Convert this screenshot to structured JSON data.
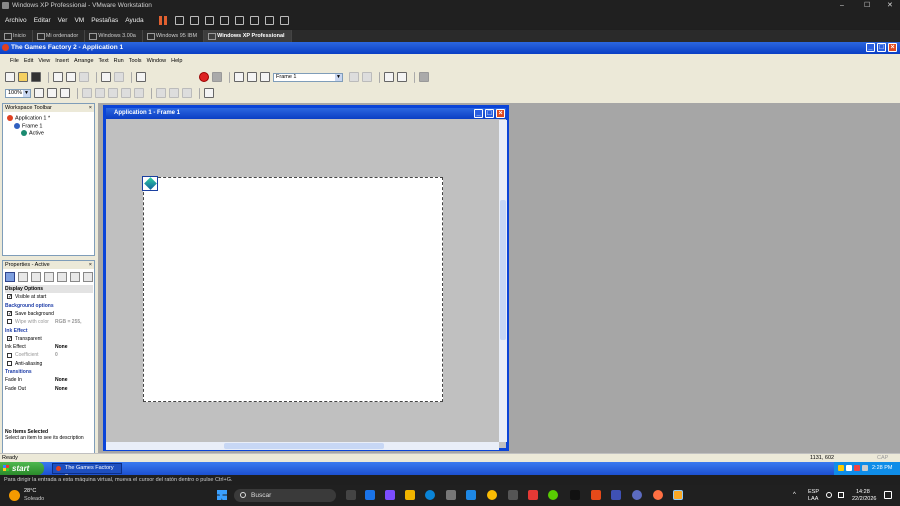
{
  "vm": {
    "window_title": "Windows XP Professional - VMware Workstation",
    "menu": [
      "Archivo",
      "Editar",
      "Ver",
      "VM",
      "Pestañas",
      "Ayuda"
    ],
    "tabs": [
      "Inicio",
      "Mi ordenador",
      "Windows 3.00a",
      "Windows 95 IBM",
      "Windows XP Professional"
    ],
    "active_tab": "Windows XP Professional",
    "window_controls": {
      "minimize": "–",
      "maximize": "☐",
      "close": "✕"
    }
  },
  "app": {
    "title": "The Games Factory 2 - Application 1",
    "menu": [
      "File",
      "Edit",
      "View",
      "Insert",
      "Arrange",
      "Text",
      "Run",
      "Tools",
      "Window",
      "Help"
    ],
    "frame_select": "Frame 1",
    "zoom": "100%"
  },
  "workspace": {
    "title": "Workspace Toolbar",
    "tree": [
      {
        "label": "Application 1 *",
        "icon": "application-icon",
        "level": 0
      },
      {
        "label": "Frame 1",
        "icon": "frame-icon",
        "level": 1
      },
      {
        "label": "Active",
        "icon": "active-object-icon",
        "level": 2
      }
    ]
  },
  "properties": {
    "title": "Properties - Active",
    "rows": [
      {
        "type": "hdr",
        "label": "Display Options"
      },
      {
        "type": "check",
        "label": "Visible at start",
        "checked": true
      },
      {
        "type": "sec",
        "label": "Background options"
      },
      {
        "type": "check",
        "label": "Save background",
        "checked": true
      },
      {
        "type": "disabled",
        "label": "Wipe with color",
        "value": "RGB = 255,"
      },
      {
        "type": "sec",
        "label": "Ink Effect"
      },
      {
        "type": "check",
        "label": "Transparent",
        "checked": true
      },
      {
        "type": "kv",
        "label": "Ink Effect",
        "value": "None"
      },
      {
        "type": "disabled",
        "label": "Coefficient",
        "value": "0"
      },
      {
        "type": "check",
        "label": "Anti-aliasing",
        "checked": false
      },
      {
        "type": "sec",
        "label": "Transitions"
      },
      {
        "type": "kv",
        "label": "Fade In",
        "value": "None"
      },
      {
        "type": "kv",
        "label": "Fade Out",
        "value": "None"
      }
    ],
    "desc_title": "No Items Selected",
    "desc_text": "Select an item to see its description"
  },
  "frame_editor": {
    "title": "Application 1 - Frame 1"
  },
  "status": {
    "left": "Ready",
    "coords": "1131, 602",
    "caps": "CAP NUM"
  },
  "xp_taskbar": {
    "start": "start",
    "item": "The Games Factory 2...",
    "clock": "2:28 PM"
  },
  "host": {
    "hint": "Para dirigir la entrada a esta máquina virtual, mueva el cursor del ratón dentro o pulse Ctrl+G.",
    "weather_temp": "28°C",
    "weather_desc": "Soleado",
    "search": "Buscar",
    "lang1": "ESP",
    "lang2": "LAA",
    "time": "14:28",
    "date": "22/2/2026"
  }
}
